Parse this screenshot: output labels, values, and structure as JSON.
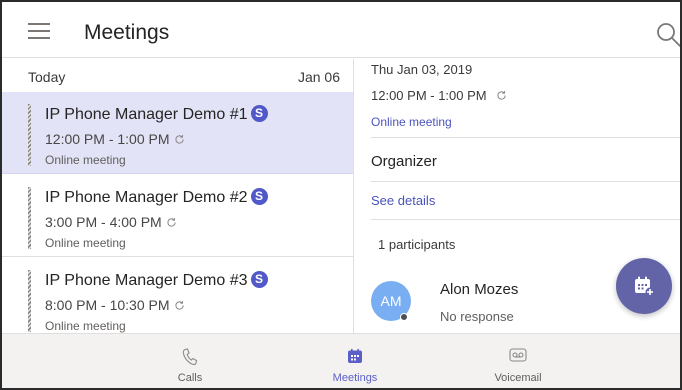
{
  "header": {
    "title": "Meetings"
  },
  "list": {
    "date_label": "Today",
    "date_value": "Jan 06",
    "meetings": [
      {
        "title": "IP Phone Manager Demo #1",
        "badge": "S",
        "time": "12:00 PM - 1:00 PM",
        "kind": "Online meeting",
        "selected": true
      },
      {
        "title": "IP Phone Manager Demo #2",
        "badge": "S",
        "time": "3:00 PM - 4:00 PM",
        "kind": "Online meeting",
        "selected": false
      },
      {
        "title": "IP Phone Manager Demo #3",
        "badge": "S",
        "time": "8:00 PM - 10:30 PM",
        "kind": "Online meeting",
        "selected": false
      }
    ]
  },
  "details": {
    "date": "Thu Jan 03, 2019",
    "time": "12:00 PM - 1:00 PM",
    "kind": "Online meeting",
    "organizer_label": "Organizer",
    "see_details": "See details",
    "participants_count": "1 participants",
    "participant": {
      "initials": "AM",
      "name": "Alon Mozes",
      "status": "No response"
    }
  },
  "nav": {
    "items": [
      {
        "label": "Calls",
        "icon": "phone-icon",
        "active": false
      },
      {
        "label": "Meetings",
        "icon": "calendar-icon",
        "active": true
      },
      {
        "label": "Voicemail",
        "icon": "voicemail-icon",
        "active": false
      }
    ]
  },
  "colors": {
    "accent": "#6264a7",
    "selected_row": "#e2e3f6",
    "link": "#4b53bc",
    "avatar": "#7aaef3"
  }
}
